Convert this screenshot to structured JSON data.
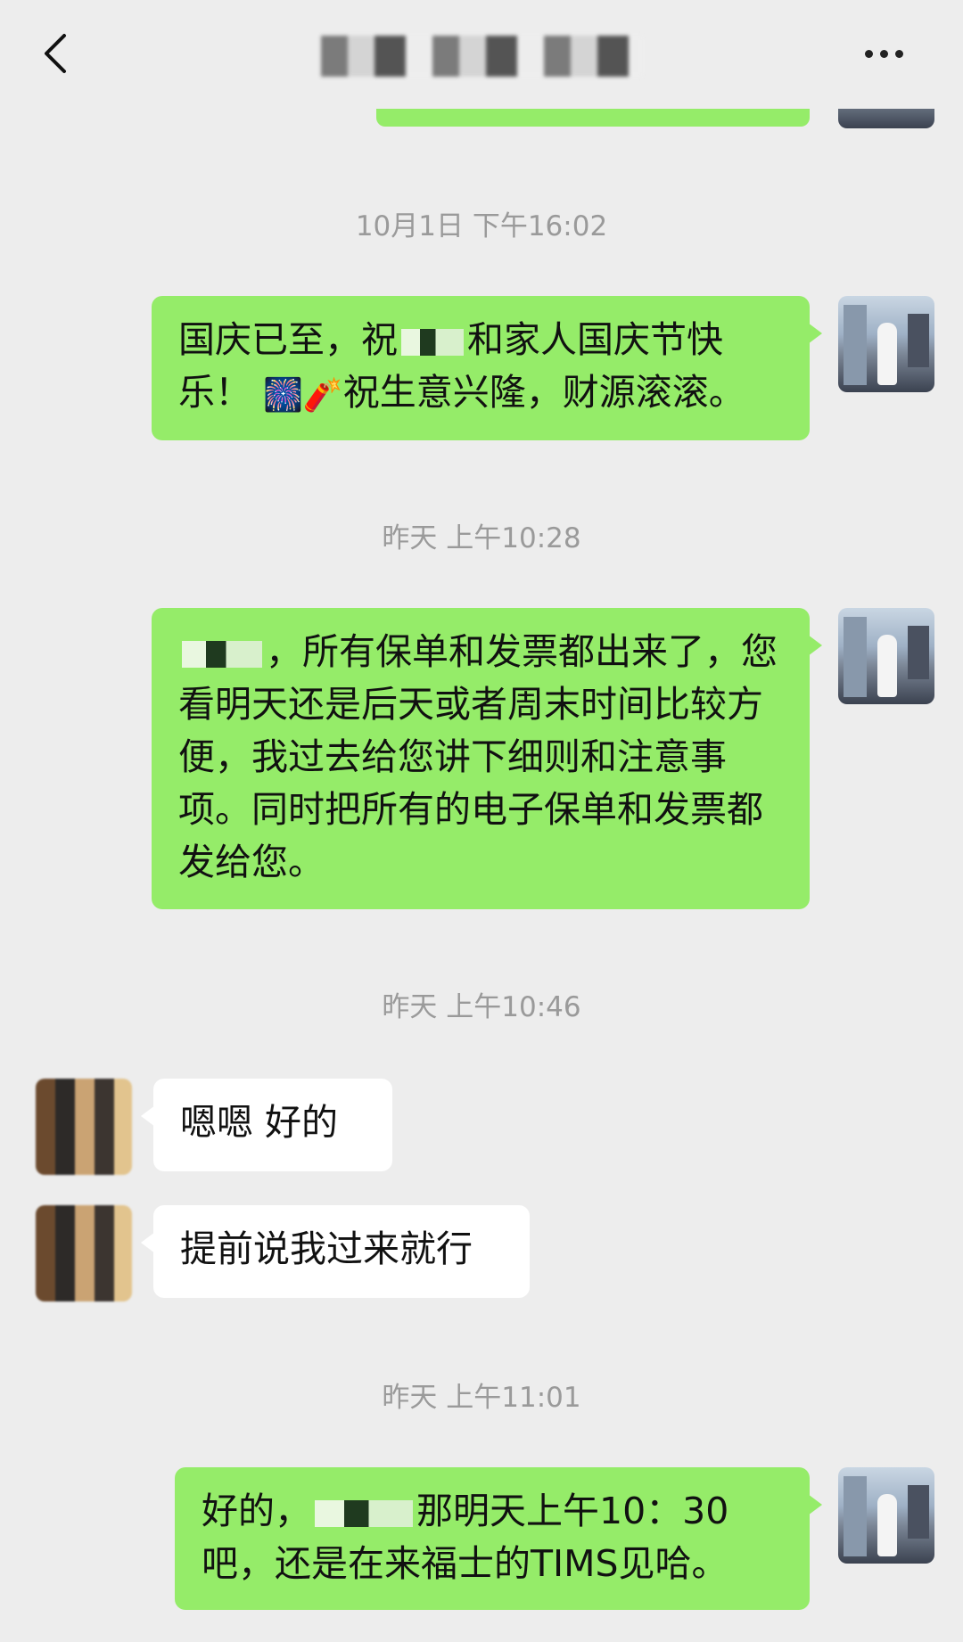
{
  "header": {
    "back_icon": "chevron-left-icon",
    "title": "",
    "more_icon": "more-dots-icon"
  },
  "messages": [
    {
      "time": "10月1日 下午16:02"
    },
    {
      "direction": "out",
      "text_a": "国庆已至，祝",
      "text_b": "和家人国庆节快乐！",
      "emoji_1": "🎆",
      "emoji_2": "🧨",
      "text_c": "祝生意兴隆，财源滚滚。"
    },
    {
      "time": "昨天 上午10:28"
    },
    {
      "direction": "out",
      "text_a": "，所有保单和发票都出来了，您看明天还是后天或者周末时间比较方便，我过去给您讲下细则和注意事项。同时把所有的电子保单和发票都发给您。"
    },
    {
      "time": "昨天 上午10:46"
    },
    {
      "direction": "in",
      "text": "嗯嗯 好的"
    },
    {
      "direction": "in",
      "text": "提前说我过来就行"
    },
    {
      "time": "昨天 上午11:01"
    },
    {
      "direction": "out",
      "text_a": "好的，",
      "text_b": "那明天上午10：30吧，还是在来福士的TIMS见哈。"
    }
  ]
}
